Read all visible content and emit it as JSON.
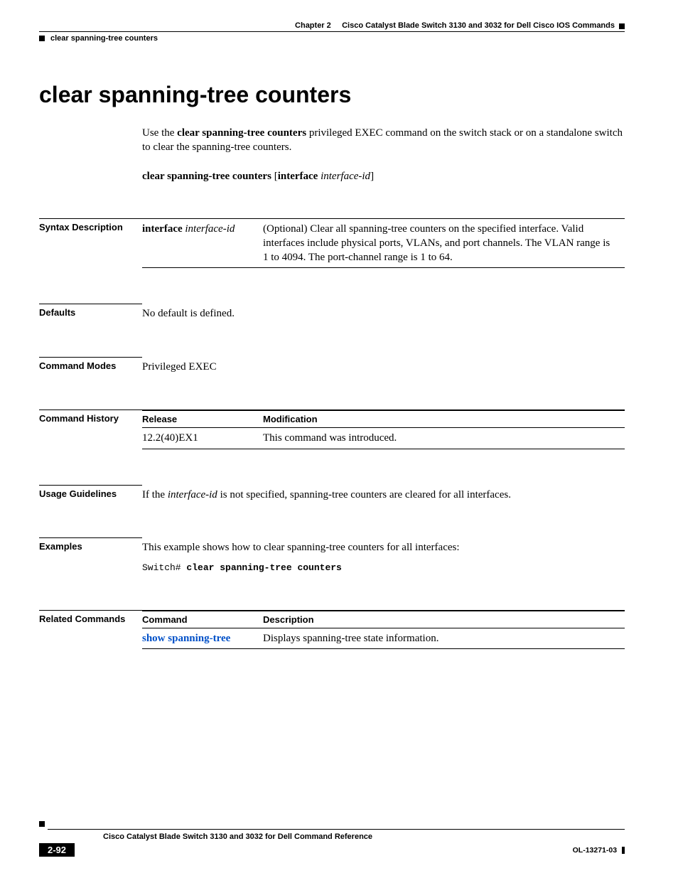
{
  "header": {
    "chapter_label": "Chapter 2",
    "chapter_title": "Cisco Catalyst Blade Switch 3130 and 3032 for Dell Cisco IOS Commands",
    "breadcrumb": "clear spanning-tree counters"
  },
  "title": "clear spanning-tree counters",
  "intro": {
    "pre": "Use the ",
    "cmd": "clear spanning-tree counters",
    "post": " privileged EXEC command on the switch stack or on a standalone switch to clear the spanning-tree counters."
  },
  "syntax": {
    "cmd": "clear spanning-tree counters",
    "open": " [",
    "kw": "interface",
    "arg": " interface-id",
    "close": "]"
  },
  "sections": {
    "syntax_desc_label": "Syntax Description",
    "syntax_desc": {
      "kw": "interface",
      "arg": " interface-id",
      "text": "(Optional) Clear all spanning-tree counters on the specified interface. Valid interfaces include physical ports, VLANs, and port channels. The VLAN range is 1 to 4094. The port-channel range is 1 to 64."
    },
    "defaults_label": "Defaults",
    "defaults_text": "No default is defined.",
    "modes_label": "Command Modes",
    "modes_text": "Privileged EXEC",
    "history_label": "Command History",
    "history": {
      "h_release": "Release",
      "h_mod": "Modification",
      "release": "12.2(40)EX1",
      "mod": "This command was introduced."
    },
    "usage_label": "Usage Guidelines",
    "usage": {
      "pre": "If the ",
      "arg": "interface-id",
      "post": " is not specified, spanning-tree counters are cleared for all interfaces."
    },
    "examples_label": "Examples",
    "examples_text": "This example shows how to clear spanning-tree counters for all interfaces:",
    "examples_code_prompt": "Switch# ",
    "examples_code_cmd": "clear spanning-tree counters",
    "related_label": "Related Commands",
    "related": {
      "h_cmd": "Command",
      "h_desc": "Description",
      "cmd": "show spanning-tree",
      "desc": "Displays spanning-tree state information."
    }
  },
  "footer": {
    "book_title": "Cisco Catalyst Blade Switch 3130 and 3032 for Dell Command Reference",
    "page_num": "2-92",
    "doc_id": "OL-13271-03"
  }
}
